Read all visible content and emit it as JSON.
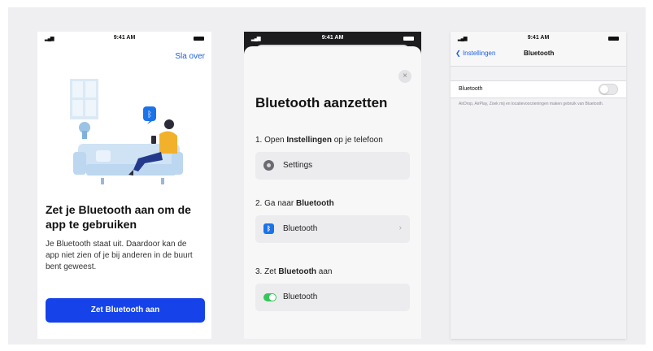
{
  "status_bar": {
    "time": "9:41 AM"
  },
  "screen1": {
    "skip_link": "Sla over",
    "title": "Zet je Bluetooth aan om de app te gebruiken",
    "body": "Je Bluetooth staat uit. Daardoor kan de app niet zien of je bij anderen in de buurt bent geweest.",
    "button": "Zet Bluetooth aan"
  },
  "screen2": {
    "close_glyph": "×",
    "title": "Bluetooth aanzetten",
    "step1": {
      "prefix": "1. Open ",
      "bold": "Instellingen",
      "suffix": " op je telefoon"
    },
    "step1_card": "Settings",
    "step2": {
      "prefix": "2. Ga naar ",
      "bold": "Bluetooth",
      "suffix": ""
    },
    "step2_card": "Bluetooth",
    "step3": {
      "prefix": "3. Zet ",
      "bold": "Bluetooth",
      "suffix": " aan"
    },
    "step3_card": "Bluetooth",
    "step3_toggle_on": true
  },
  "screen3": {
    "back_label": "Instellingen",
    "nav_title": "Bluetooth",
    "row_label": "Bluetooth",
    "toggle_on": false,
    "footnote": "AirDrop, AirPlay, Zoek mij en locatievoorzieningen maken gebruik van Bluetooth."
  },
  "colors": {
    "primary_button": "#1542e9",
    "link": "#1d5fe0",
    "toggle_on": "#34c759"
  }
}
